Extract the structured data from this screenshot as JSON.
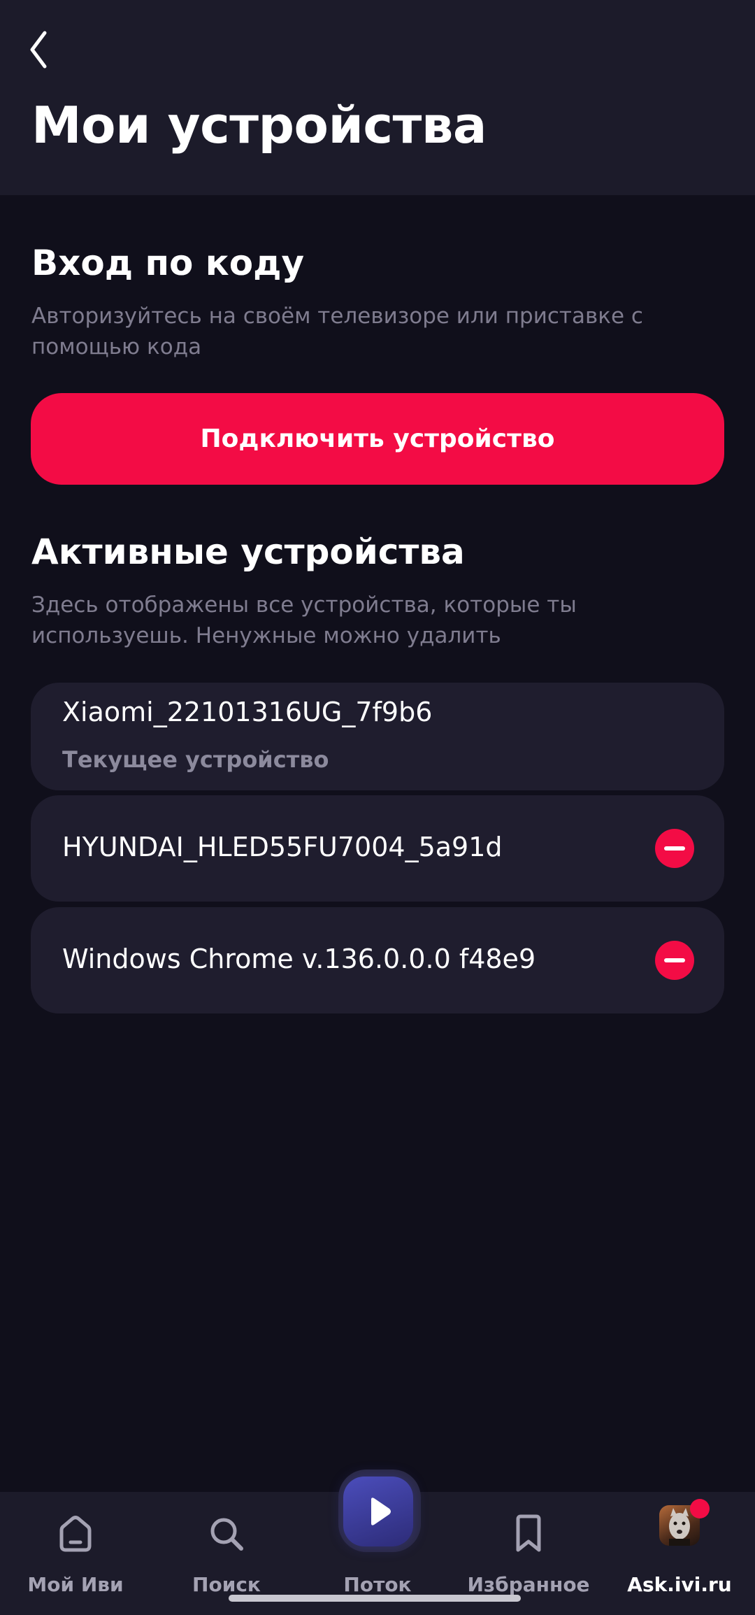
{
  "header": {
    "title": "Мои устройства",
    "back_icon": "chevron-left-icon"
  },
  "code_login": {
    "title": "Вход по коду",
    "description": "Авторизуйтесь на своём телевизоре или приставке с помощью кода",
    "button_label": "Подключить устройство"
  },
  "active_devices": {
    "title": "Активные устройства",
    "description": "Здесь отображены все устройства, которые ты используешь. Ненужные можно удалить",
    "devices": [
      {
        "name": "Xiaomi_22101316UG_7f9b6",
        "subtitle": "Текущее устройство",
        "removable": false
      },
      {
        "name": "HYUNDAI_HLED55FU7004_5a91d",
        "removable": true
      },
      {
        "name": "Windows Chrome v.136.0.0.0 f48e9",
        "removable": true
      }
    ]
  },
  "tabbar": {
    "items": [
      {
        "label": "Мой Иви",
        "icon": "home-icon"
      },
      {
        "label": "Поиск",
        "icon": "search-icon"
      },
      {
        "label": "Поток",
        "icon": "play-icon"
      },
      {
        "label": "Избранное",
        "icon": "bookmark-icon"
      },
      {
        "label": "Ask.ivi.ru",
        "icon": "avatar-icon",
        "active": true
      }
    ]
  },
  "colors": {
    "accent": "#f30c45",
    "background": "#100f1b",
    "surface": "#1f1d2e",
    "header": "#1c1b2a"
  }
}
